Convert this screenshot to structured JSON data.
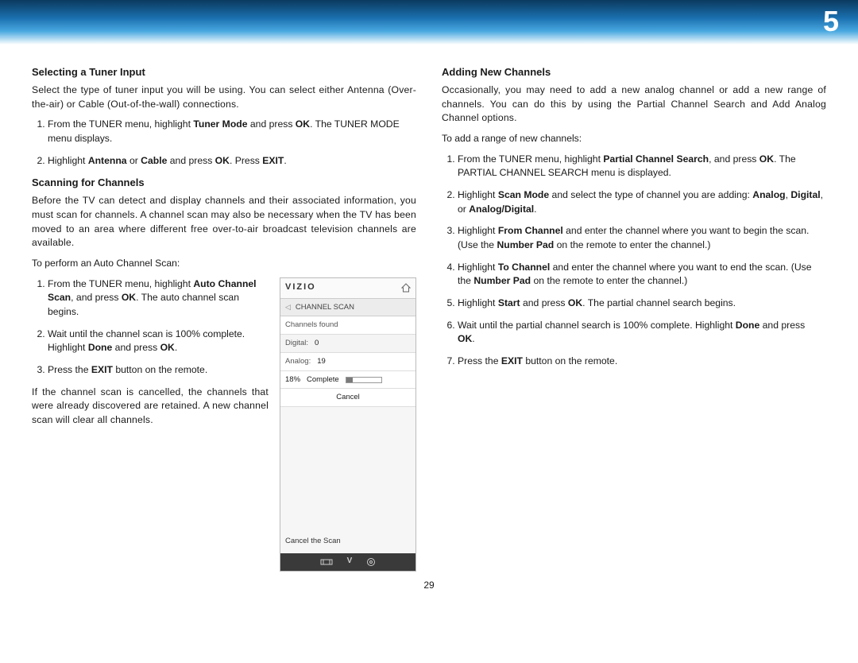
{
  "banner": {
    "chapter_number": "5"
  },
  "page_number": "29",
  "left": {
    "h1": "Selecting a Tuner Input",
    "p1": "Select the type of tuner input you will be using. You can select either Antenna (Over-the-air) or Cable (Out-of-the-wall) connections.",
    "s1": {
      "li1_a": "From the TUNER menu, highlight ",
      "li1_b": "Tuner Mode",
      "li1_c": " and press ",
      "li1_d": "OK",
      "li1_e": ". The TUNER MODE menu displays.",
      "li2_a": "Highlight ",
      "li2_b": "Antenna",
      "li2_c": " or ",
      "li2_d": "Cable",
      "li2_e": " and press ",
      "li2_f": "OK",
      "li2_g": ". Press ",
      "li2_h": "EXIT",
      "li2_i": "."
    },
    "h2": "Scanning for Channels",
    "p2": "Before the TV can detect and display channels and their associated information, you must scan for channels. A channel scan may also be necessary when the TV has been moved to an area where different free over-to-air broadcast television channels are available.",
    "p3": "To perform an Auto Channel Scan:",
    "s2": {
      "li1_a": "From the TUNER menu, highlight ",
      "li1_b": "Auto Channel Scan",
      "li1_c": ", and press ",
      "li1_d": "OK",
      "li1_e": ". The auto channel scan begins.",
      "li2_a": "Wait until the channel scan is 100% complete. Highlight ",
      "li2_b": "Done",
      "li2_c": " and press ",
      "li2_d": "OK",
      "li2_e": ".",
      "li3_a": "Press the ",
      "li3_b": "EXIT",
      "li3_c": " button on the remote."
    },
    "p4": "If the channel scan is cancelled, the channels that were already discovered are retained. A new channel scan will clear all channels."
  },
  "panel": {
    "brand": "VIZIO",
    "section": "CHANNEL SCAN",
    "found_label": "Channels found",
    "digital_label": "Digital:",
    "digital_value": "0",
    "analog_label": "Analog:",
    "analog_value": "19",
    "pct": "18%",
    "pct_num": 18,
    "complete": "Complete",
    "cancel": "Cancel",
    "hint": "Cancel the Scan"
  },
  "right": {
    "h1": "Adding New Channels",
    "p1": "Occasionally, you may need to add a new analog channel or add a new range of channels. You can do this by using the Partial Channel Search and Add Analog Channel options.",
    "p2": "To add a range of new channels:",
    "s1": {
      "li1_a": "From the TUNER menu, highlight ",
      "li1_b": "Partial Channel Search",
      "li1_c": ", and press ",
      "li1_d": "OK",
      "li1_e": ". The PARTIAL CHANNEL SEARCH menu is displayed.",
      "li2_a": "Highlight ",
      "li2_b": "Scan Mode",
      "li2_c": " and select the type of channel you are adding: ",
      "li2_d": "Analog",
      "li2_e": ", ",
      "li2_f": "Digital",
      "li2_g": ", or ",
      "li2_h": "Analog/Digital",
      "li2_i": ".",
      "li3_a": "Highlight ",
      "li3_b": "From Channel",
      "li3_c": " and enter the channel where you want to begin the scan. (Use the ",
      "li3_d": "Number Pad",
      "li3_e": " on the remote to enter the channel.)",
      "li4_a": "Highlight ",
      "li4_b": "To Channel",
      "li4_c": " and enter the channel where you want to end the scan. (Use the ",
      "li4_d": "Number Pad",
      "li4_e": " on the remote to enter the channel.)",
      "li5_a": "Highlight ",
      "li5_b": "Start",
      "li5_c": " and press ",
      "li5_d": "OK",
      "li5_e": ". The partial channel search begins.",
      "li6_a": "Wait until the partial channel search is 100% complete. Highlight ",
      "li6_b": "Done",
      "li6_c": " and press ",
      "li6_d": "OK",
      "li6_e": ".",
      "li7_a": "Press the ",
      "li7_b": "EXIT",
      "li7_c": " button on the remote."
    }
  }
}
